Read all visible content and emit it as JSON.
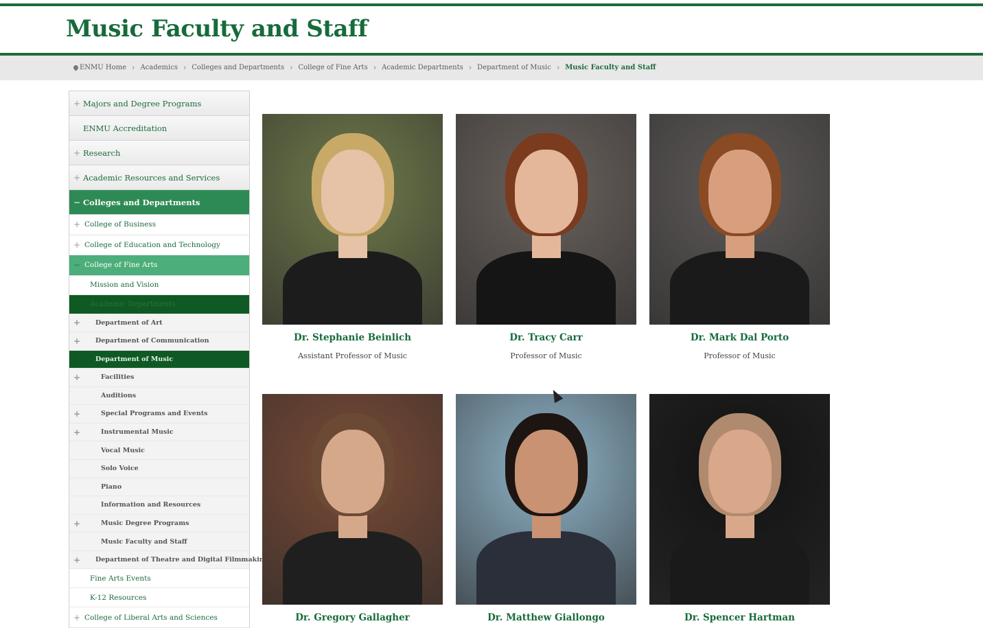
{
  "header": {
    "title": "Music Faculty and Staff"
  },
  "breadcrumb": [
    "ENMU Home",
    "Academics",
    "Colleges and Departments",
    "College of Fine Arts",
    "Academic Departments",
    "Department of Music",
    "Music Faculty and Staff"
  ],
  "sidebar": {
    "top": [
      {
        "label": "Majors and Degree Programs"
      },
      {
        "label": "ENMU Accreditation"
      },
      {
        "label": "Research"
      },
      {
        "label": "Academic Resources and Services"
      },
      {
        "label": "Colleges and Departments"
      }
    ],
    "colleges": [
      {
        "label": "College of Business"
      },
      {
        "label": "College of Education and Technology"
      },
      {
        "label": "College of Fine Arts"
      }
    ],
    "fine_arts": [
      {
        "label": "Mission and Vision"
      },
      {
        "label": "Academic Departments"
      }
    ],
    "departments": [
      {
        "label": "Department of Art"
      },
      {
        "label": "Department of Communication"
      },
      {
        "label": "Department of Music"
      }
    ],
    "music": [
      {
        "label": "Facilities"
      },
      {
        "label": "Auditions"
      },
      {
        "label": "Special Programs and Events"
      },
      {
        "label": "Instrumental Music"
      },
      {
        "label": "Vocal Music"
      },
      {
        "label": "Solo Voice"
      },
      {
        "label": "Piano"
      },
      {
        "label": "Information and Resources"
      },
      {
        "label": "Music Degree Programs"
      },
      {
        "label": "Music Faculty and Staff"
      }
    ],
    "after_music": [
      {
        "label": "Department of Theatre and Digital Filmmaking"
      }
    ],
    "fine_arts_more": [
      {
        "label": "Fine Arts Events"
      },
      {
        "label": "K-12 Resources"
      }
    ],
    "colleges_more": [
      {
        "label": "College of Liberal Arts and Sciences"
      }
    ]
  },
  "faculty": [
    {
      "name": "Dr. Stephanie Beinlich",
      "title": "Assistant Professor of Music",
      "bg": "#6f7a4a",
      "hair": "#c9a968",
      "skin": "#e6c2a6",
      "clothes": "#1c1c1c"
    },
    {
      "name": "Dr. Tracy Carr",
      "title": "Professor of Music",
      "bg": "#6a625d",
      "hair": "#7a3b1f",
      "skin": "#e5b79a",
      "clothes": "#151515"
    },
    {
      "name": "Dr. Mark Dal Porto",
      "title": "Professor of Music",
      "bg": "#5d5957",
      "hair": "#8a4a24",
      "skin": "#d79f7e",
      "clothes": "#1a1a1a"
    },
    {
      "name": "Dr. Gregory Gallagher",
      "title": "",
      "bg": "#7a4a35",
      "hair": "#6b4a35",
      "skin": "#d6a88a",
      "clothes": "#1f1f1f"
    },
    {
      "name": "Dr. Matthew Giallongo",
      "title": "",
      "bg": "#8fb4c9",
      "hair": "#1c1512",
      "skin": "#c99272",
      "clothes": "#2b2f3a"
    },
    {
      "name": "Dr. Spencer Hartman",
      "title": "",
      "bg": "#121212",
      "hair": "#b08a6e",
      "skin": "#d9a78a",
      "clothes": "#1a1a1a"
    }
  ]
}
